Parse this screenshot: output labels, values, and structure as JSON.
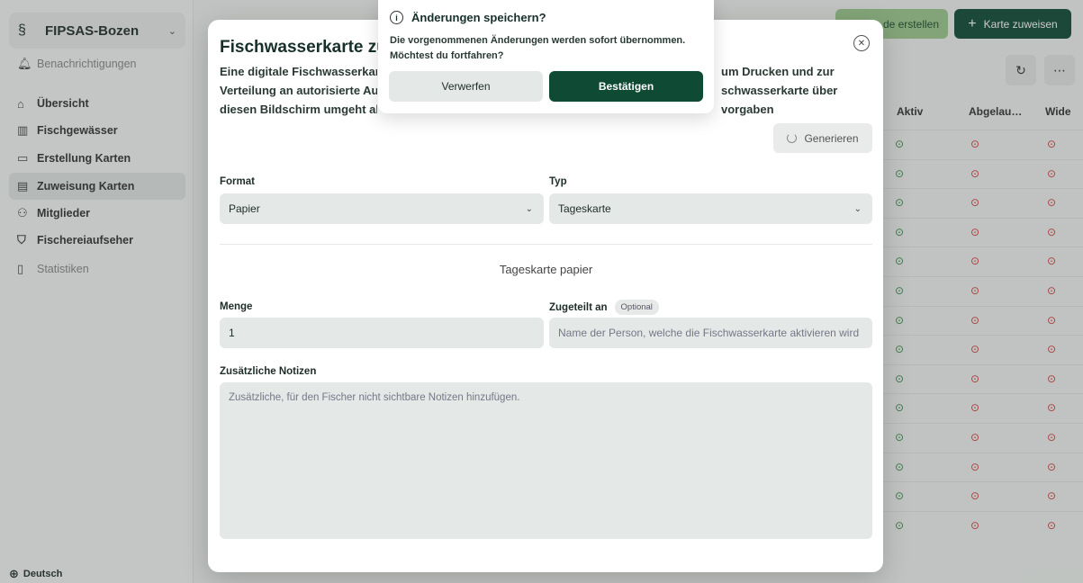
{
  "sidebar": {
    "org_name": "FIPSAS-Bozen",
    "notifications": "Benachrichtigungen",
    "items": [
      {
        "label": "Übersicht",
        "icon": "home-icon"
      },
      {
        "label": "Fischgewässer",
        "icon": "map-icon"
      },
      {
        "label": "Erstellung Karten",
        "icon": "card-create-icon"
      },
      {
        "label": "Zuweisung Karten",
        "icon": "card-assign-icon"
      },
      {
        "label": "Mitglieder",
        "icon": "users-icon"
      },
      {
        "label": "Fischereiaufseher",
        "icon": "shield-icon"
      },
      {
        "label": "Statistiken",
        "icon": "chart-icon"
      }
    ],
    "language": "Deutsch"
  },
  "header": {
    "create_label": "de erstellen",
    "assign_label": "Karte zuweisen"
  },
  "table": {
    "columns": [
      "Aktiv",
      "Abgelau…",
      "Wide"
    ],
    "row_count": 14
  },
  "modal": {
    "title": "Fischwasserkarte zu",
    "description": "Eine digitale Fischwasserkart                                                                  um Drucken und zur Verteilung an autorisierte Au:                                                                  schwasserkarte über diesen Bildschirm umgeht all                                                                  vorgaben",
    "generate_label": "Generieren",
    "format_label": "Format",
    "format_value": "Papier",
    "type_label": "Typ",
    "type_value": "Tageskarte",
    "section_title": "Tageskarte papier",
    "quantity_label": "Menge",
    "quantity_value": "1",
    "assigned_label": "Zugeteilt an",
    "optional_badge": "Optional",
    "assigned_placeholder": "Name der Person, welche die Fischwasserkarte aktivieren wird",
    "notes_label": "Zusätzliche Notizen",
    "notes_placeholder": "Zusätzliche, für den Fischer nicht sichtbare Notizen hinzufügen."
  },
  "popover": {
    "title": "Änderungen speichern?",
    "text_line1": "Die vorgenommenen Änderungen werden sofort übernommen.",
    "text_line2": "Möchtest du fortfahren?",
    "discard_label": "Verwerfen",
    "confirm_label": "Bestätigen"
  },
  "colors": {
    "brand_dark": "#0f4a35",
    "brand_light": "#9fc98e",
    "active_ok": "#3a8a4c",
    "expired": "#d23b3b"
  }
}
